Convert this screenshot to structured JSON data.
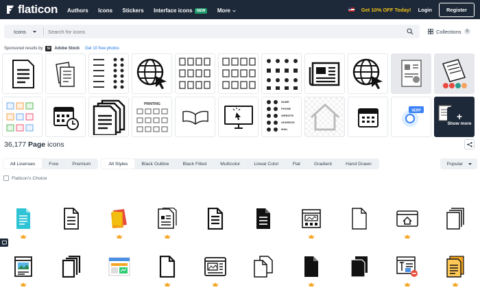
{
  "header": {
    "logo_text": "flaticon",
    "nav": [
      {
        "label": "Authors"
      },
      {
        "label": "Icons"
      },
      {
        "label": "Stickers"
      },
      {
        "label": "Interface icons",
        "badge": "NEW"
      },
      {
        "label": "More"
      }
    ],
    "promo": "Get 10% OFF Today!",
    "login": "Login",
    "register": "Register"
  },
  "search": {
    "type_value": "Icons",
    "placeholder": "Search for icons",
    "collections_label": "Collections",
    "collections_count": "0"
  },
  "sponsored": {
    "prefix": "Sponsored results by",
    "logo": "St",
    "brand": "Adobe Stock",
    "link": "Get 10 free photos",
    "show_more": "Show more"
  },
  "results": {
    "count": "36,177",
    "term": "Page",
    "suffix": "icons"
  },
  "filters": {
    "licenses": [
      {
        "label": "All Licenses",
        "active": true
      },
      {
        "label": "Free",
        "active": false
      },
      {
        "label": "Premium",
        "active": false
      }
    ],
    "styles": [
      {
        "label": "All Styles",
        "active": true
      },
      {
        "label": "Black Outline",
        "active": false
      },
      {
        "label": "Black Filled",
        "active": false
      },
      {
        "label": "Multicolor",
        "active": false
      },
      {
        "label": "Lineal Color",
        "active": false
      },
      {
        "label": "Flat",
        "active": false
      },
      {
        "label": "Gradient",
        "active": false
      },
      {
        "label": "Hand Drawn",
        "active": false
      }
    ],
    "sort": "Popular",
    "choice_label": "Flaticon's Choice"
  },
  "colors": {
    "topbar": "#1d2838",
    "promo": "#f5c518",
    "premium_crown": "#f5a623",
    "link": "#1a73e8"
  }
}
